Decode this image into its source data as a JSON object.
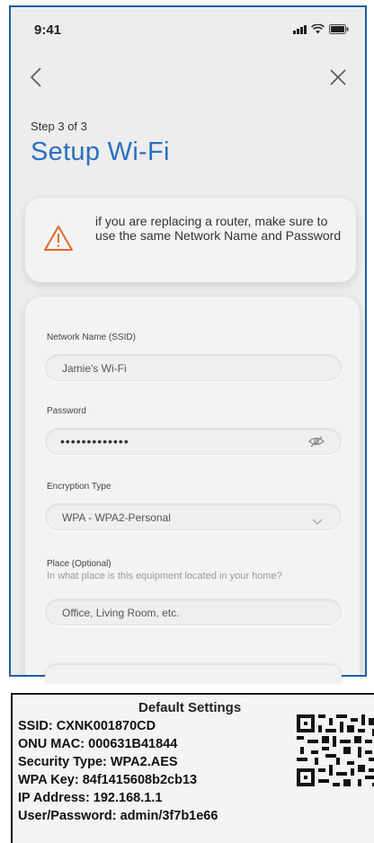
{
  "status_bar": {
    "time": "9:41"
  },
  "setup": {
    "step_label": "Step 3 of 3",
    "title": "Setup Wi-Fi",
    "warning_text": "if you are replacing a router, make sure to use the same Network Name and Password"
  },
  "form": {
    "ssid_label": "Network Name (SSID)",
    "ssid_value": "Jamie's Wi-Fi",
    "password_label": "Password",
    "password_value": "•••••••••••••",
    "encryption_label": "Encryption Type",
    "encryption_value": "WPA - WPA2-Personal",
    "place_label": "Place (Optional)",
    "place_hint": "In what place is this equipment located in your home?",
    "place_placeholder": "Office, Living Room, etc."
  },
  "label_sticker": {
    "title": "Default Settings",
    "lines": [
      "SSID: CXNK001870CD",
      "ONU MAC: 000631B41844",
      "Security Type: WPA2.AES",
      "WPA Key: 84f1415608b2cb13",
      "IP Address: 192.168.1.1",
      "User/Password: admin/3f7b1e66"
    ]
  },
  "colors": {
    "accent": "#2a6fc0",
    "warning": "#e0692b",
    "frame": "#1f5fa8"
  },
  "icons": [
    "back-icon",
    "close-icon",
    "warning-icon",
    "eye-icon",
    "chevron-down-icon",
    "qr-code-icon"
  ]
}
